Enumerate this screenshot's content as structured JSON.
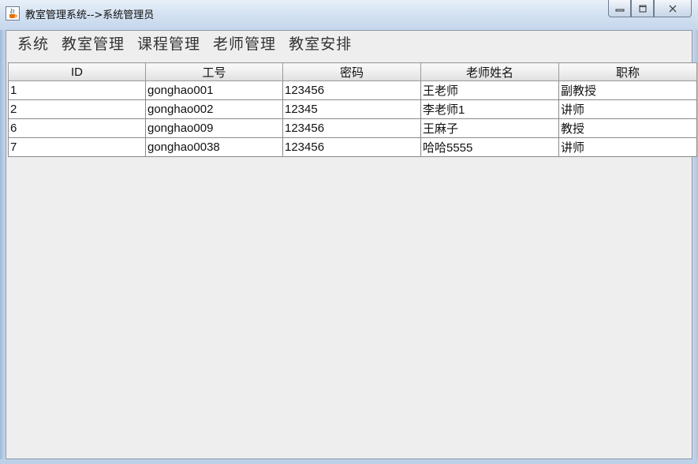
{
  "window": {
    "title": "教室管理系统-->系统管理员",
    "icon": "java-cup-icon",
    "controls": [
      "minimize-icon",
      "maximize-icon",
      "close-icon"
    ]
  },
  "menu": {
    "items": [
      {
        "label": "系统"
      },
      {
        "label": "教室管理"
      },
      {
        "label": "课程管理"
      },
      {
        "label": "老师管理"
      },
      {
        "label": "教室安排"
      }
    ]
  },
  "table": {
    "headers": [
      "ID",
      "工号",
      "密码",
      "老师姓名",
      "职称"
    ],
    "rows": [
      [
        "1",
        "gonghao001",
        "123456",
        "王老师",
        "副教授"
      ],
      [
        "2",
        "gonghao002",
        "12345",
        "李老师1",
        "讲师"
      ],
      [
        "6",
        "gonghao009",
        "123456",
        "王麻子",
        "教授"
      ],
      [
        "7",
        "gonghao0038",
        "123456",
        "哈哈5555",
        "讲师"
      ]
    ]
  }
}
